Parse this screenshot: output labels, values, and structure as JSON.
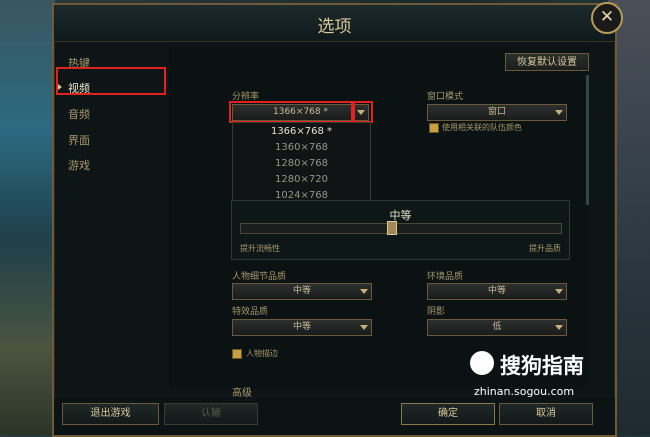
{
  "window": {
    "title": "选项"
  },
  "sidebar": {
    "items": [
      {
        "label": "热键"
      },
      {
        "label": "视频"
      },
      {
        "label": "音频"
      },
      {
        "label": "界面"
      },
      {
        "label": "游戏"
      }
    ]
  },
  "header": {
    "restore_defaults": "恢复默认设置"
  },
  "resolution": {
    "label": "分辨率",
    "value": "1366×768 *",
    "options": [
      "1366×768 *",
      "1360×768",
      "1280×768",
      "1280×720",
      "1024×768"
    ]
  },
  "window_mode": {
    "label": "窗口模式",
    "value": "窗口",
    "checkbox_label": "使用相关联的队伍颜色"
  },
  "quality": {
    "level": "中等",
    "left_label": "提升流畅性",
    "right_label": "提升品质"
  },
  "settings": {
    "character_quality": {
      "label": "人物细节品质",
      "value": "中等"
    },
    "environment_quality": {
      "label": "环境品质",
      "value": "中等"
    },
    "effects_quality": {
      "label": "特效品质",
      "value": "中等"
    },
    "shadows": {
      "label": "阴影",
      "value": "低"
    },
    "outline_label": "人物描边",
    "advanced_label": "高级"
  },
  "footer": {
    "exit_game": "退出游戏",
    "surrender": "认输",
    "ok": "确定",
    "cancel": "取消"
  },
  "watermark": {
    "text": "搜狗指南",
    "url": "zhinan.sogou.com"
  }
}
